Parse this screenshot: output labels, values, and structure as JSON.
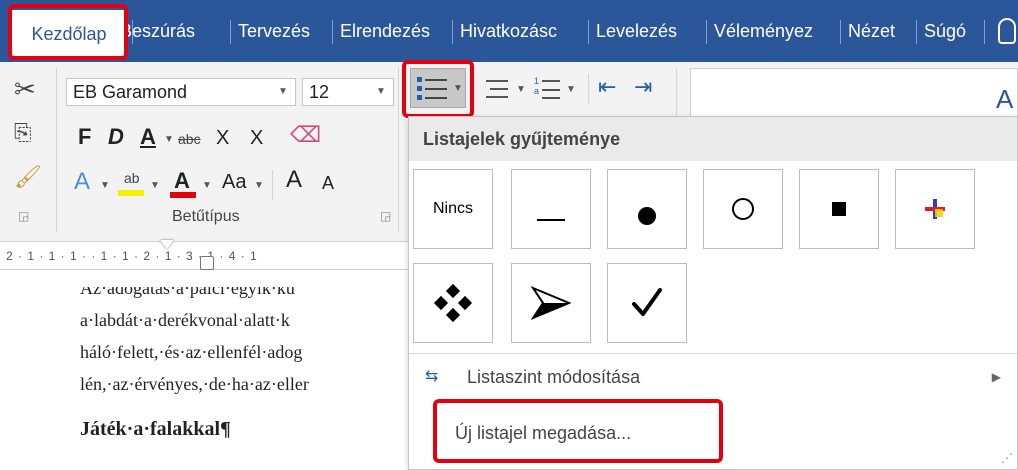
{
  "tabs": [
    {
      "label": "Kezdőlap",
      "active": true
    },
    {
      "label": "Beszúrás"
    },
    {
      "label": "Tervezés"
    },
    {
      "label": "Elrendezés"
    },
    {
      "label": "Hivatkozásc"
    },
    {
      "label": "Levelezés"
    },
    {
      "label": "Véleményez"
    },
    {
      "label": "Nézet"
    },
    {
      "label": "Súgó"
    }
  ],
  "font": {
    "family": "EB Garamond",
    "size": "12",
    "group_label": "Betűtípus"
  },
  "ribbon_buttons": {
    "bold": "F",
    "italic": "D",
    "underline": "A",
    "strike": "abc",
    "subscript": "X",
    "superscript": "X",
    "change_case": "Aa",
    "grow": "A",
    "shrink": "A"
  },
  "ruler": "2 · 1 · 1 · 1 ·  · 1 · 1 · 2 · 1 · 3 · 1 · 4 · 1",
  "document": {
    "lines": [
      "Az·adogatás·a·pálcí·egyik·kü",
      "a·labdát·a·derékvonal·alatt·k",
      "háló·felett,·és·az·ellenfél·adog",
      "lén,·az·érvényes,·de·ha·az·eller"
    ],
    "heading": "Játék·a·falakkal¶"
  },
  "bullet_library": {
    "title": "Listajelek gyűjteménye",
    "none_label": "Nincs",
    "cells": [
      {
        "icon": "dash-bullet-icon"
      },
      {
        "icon": "filled-circle-bullet-icon"
      },
      {
        "icon": "hollow-circle-bullet-icon"
      },
      {
        "icon": "filled-square-bullet-icon"
      },
      {
        "icon": "colored-cross-bullet-icon"
      },
      {
        "icon": "four-diamond-bullet-icon"
      },
      {
        "icon": "arrowhead-bullet-icon"
      },
      {
        "icon": "checkmark-bullet-icon"
      }
    ],
    "change_level": "Listaszint módosítása",
    "define_new": "Új listajel megadása..."
  },
  "colors": {
    "ribbon_blue": "#2b579a",
    "highlight_red": "#e3000f"
  }
}
